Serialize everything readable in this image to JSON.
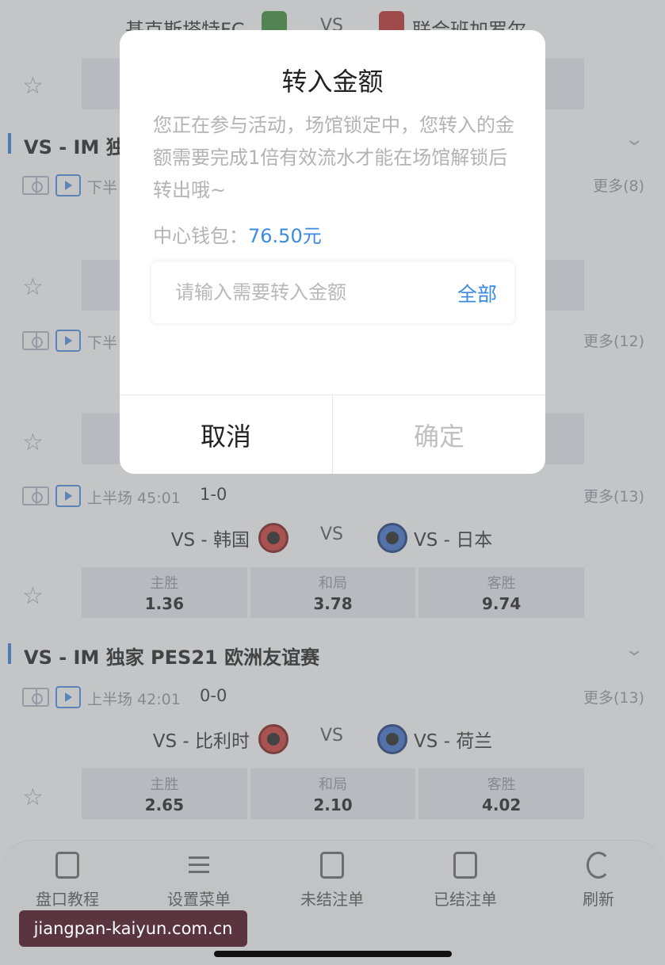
{
  "top_match": {
    "home": "基克斯塔特FC",
    "vs": "VS",
    "away": "联合班加罗尔"
  },
  "league_1": {
    "name": "VS - IM 独家"
  },
  "match_a": {
    "period": "下半",
    "more": "更多(8)"
  },
  "match_b": {
    "period": "下半",
    "more": "更多(12)"
  },
  "match_c": {
    "period": "上半场 45:01",
    "score": "1-0",
    "more": "更多(13)",
    "home": "VS - 韩国",
    "vs": "VS",
    "away": "VS - 日本",
    "odds": [
      {
        "label": "主胜",
        "value": "1.36"
      },
      {
        "label": "和局",
        "value": "3.78"
      },
      {
        "label": "客胜",
        "value": "9.74"
      }
    ]
  },
  "league_2": {
    "name": "VS - IM 独家 PES21 欧洲友谊赛"
  },
  "match_d": {
    "period": "上半场 42:01",
    "score": "0-0",
    "more": "更多(13)",
    "home": "VS - 比利时",
    "vs": "VS",
    "away": "VS - 荷兰",
    "odds": [
      {
        "label": "主胜",
        "value": "2.65"
      },
      {
        "label": "和局",
        "value": "2.10"
      },
      {
        "label": "客胜",
        "value": "4.02"
      }
    ]
  },
  "bottom_nav": [
    {
      "label": "盘口教程",
      "icon": "document-icon"
    },
    {
      "label": "设置菜单",
      "icon": "sliders-icon"
    },
    {
      "label": "未结注单",
      "icon": "clipboard-icon"
    },
    {
      "label": "已结注单",
      "icon": "yen-clipboard-icon"
    },
    {
      "label": "刷新",
      "icon": "refresh-icon"
    }
  ],
  "watermark": "jiangpan-kaiyun.com.cn",
  "dialog": {
    "title": "转入金额",
    "message": "您正在参与活动，场馆锁定中，您转入的金额需要完成1倍有效流水才能在场馆解锁后转出哦~",
    "wallet_label": "中心钱包：",
    "wallet_amount": "76.50元",
    "input_placeholder": "请输入需要转入金额",
    "all_label": "全部",
    "cancel_label": "取消",
    "confirm_label": "确定"
  },
  "colors": {
    "accent": "#3a8be0",
    "league_bar": "#3a7bd5"
  }
}
